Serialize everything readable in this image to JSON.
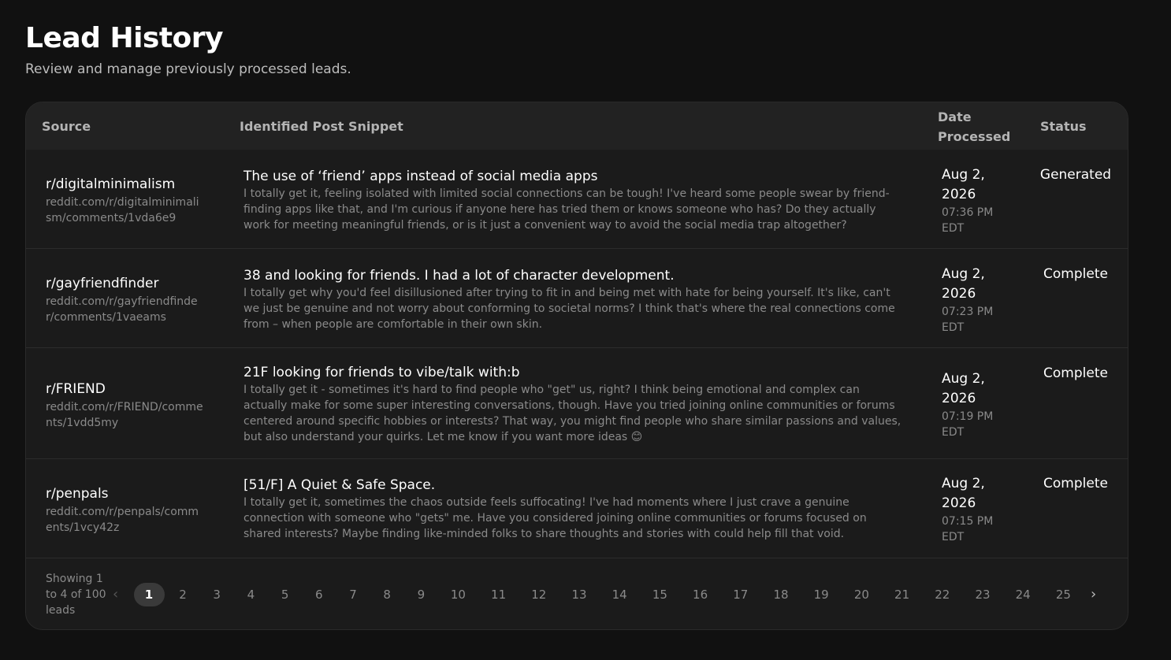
{
  "page": {
    "title": "Lead History",
    "subtitle": "Review and manage previously processed leads."
  },
  "table": {
    "headers": {
      "source": "Source",
      "snippet": "Identified Post Snippet",
      "date": "Date Processed",
      "status": "Status"
    },
    "rows": [
      {
        "source_name": "r/digitalminimalism",
        "source_url": "reddit.com/r/digitalminimalism/comments/1vda6e9",
        "title": "The use of ‘friend’ apps instead of social media apps",
        "body": "I totally get it, feeling isolated with limited social connections can be tough! I've heard some people swear by friend-finding apps like that, and I'm curious if anyone here has tried them or knows someone who has? Do they actually work for meeting meaningful friends, or is it just a convenient way to avoid the social media trap altogether?",
        "date": "Aug 2, 2026",
        "time": "07:36 PM EDT",
        "status": "Generated"
      },
      {
        "source_name": "r/gayfriendfinder",
        "source_url": "reddit.com/r/gayfriendfinder/comments/1vaeams",
        "title": "38 and looking for friends. I had a lot of character development.",
        "body": "I totally get why you'd feel disillusioned after trying to fit in and being met with hate for being yourself. It's like, can't we just be genuine and not worry about conforming to societal norms? I think that's where the real connections come from – when people are comfortable in their own skin.",
        "date": "Aug 2, 2026",
        "time": "07:23 PM EDT",
        "status": "Complete"
      },
      {
        "source_name": "r/FRIEND",
        "source_url": "reddit.com/r/FRIEND/comments/1vdd5my",
        "title": "21F looking for friends to vibe/talk with:b",
        "body": "I totally get it - sometimes it's hard to find people who \"get\" us, right? I think being emotional and complex can actually make for some super interesting conversations, though. Have you tried joining online communities or forums centered around specific hobbies or interests? That way, you might find people who share similar passions and values, but also understand your quirks. Let me know if you want more ideas 😊",
        "date": "Aug 2, 2026",
        "time": "07:19 PM EDT",
        "status": "Complete"
      },
      {
        "source_name": "r/penpals",
        "source_url": "reddit.com/r/penpals/comments/1vcy42z",
        "title": "[51/F] A Quiet & Safe Space.",
        "body": "I totally get it, sometimes the chaos outside feels suffocating! I've had moments where I just crave a genuine connection with someone who \"gets\" me. Have you considered joining online communities or forums focused on shared interests? Maybe finding like-minded folks to share thoughts and stories with could help fill that void.",
        "date": "Aug 2, 2026",
        "time": "07:15 PM EDT",
        "status": "Complete"
      }
    ]
  },
  "pagination": {
    "showing": "Showing 1 to 4 of 100 leads",
    "prev_icon": "chevron-left-icon",
    "next_icon": "chevron-right-icon",
    "active_page": "1",
    "pages": [
      "1",
      "2",
      "3",
      "4",
      "5",
      "6",
      "7",
      "8",
      "9",
      "10",
      "11",
      "12",
      "13",
      "14",
      "15",
      "16",
      "17",
      "18",
      "19",
      "20",
      "21",
      "22",
      "23",
      "24",
      "25"
    ]
  },
  "colors": {
    "background": "#111111",
    "card": "#1b1b1b",
    "header": "#222222",
    "muted_text": "#8a8a8a",
    "active_page_bg": "#3a3a3a"
  }
}
